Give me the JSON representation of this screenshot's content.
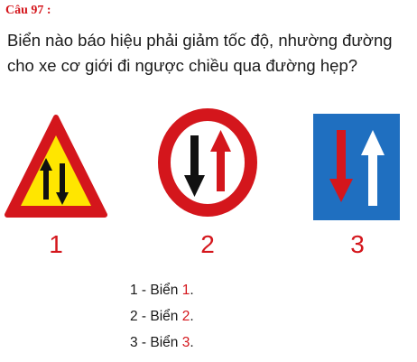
{
  "question": {
    "number_label": "Câu 97 :",
    "text": "Biển nào báo hiệu phải giảm tốc độ, nhường đường cho xe cơ giới đi ngược chiều qua đường hẹp?"
  },
  "signs": [
    {
      "label": "1",
      "icon": "triangle-two-way-arrows-icon"
    },
    {
      "label": "2",
      "icon": "circle-priority-oncoming-icon"
    },
    {
      "label": "3",
      "icon": "square-priority-over-oncoming-icon"
    }
  ],
  "answers": [
    {
      "prefix": "1 - Biển ",
      "num": "1",
      "suffix": "."
    },
    {
      "prefix": "2 - Biển ",
      "num": "2",
      "suffix": "."
    },
    {
      "prefix": "3 - Biển ",
      "num": "3",
      "suffix": "."
    }
  ],
  "colors": {
    "accent": "#d4161c",
    "warning_yellow": "#ffe600",
    "sign_blue": "#1f6fc0"
  }
}
